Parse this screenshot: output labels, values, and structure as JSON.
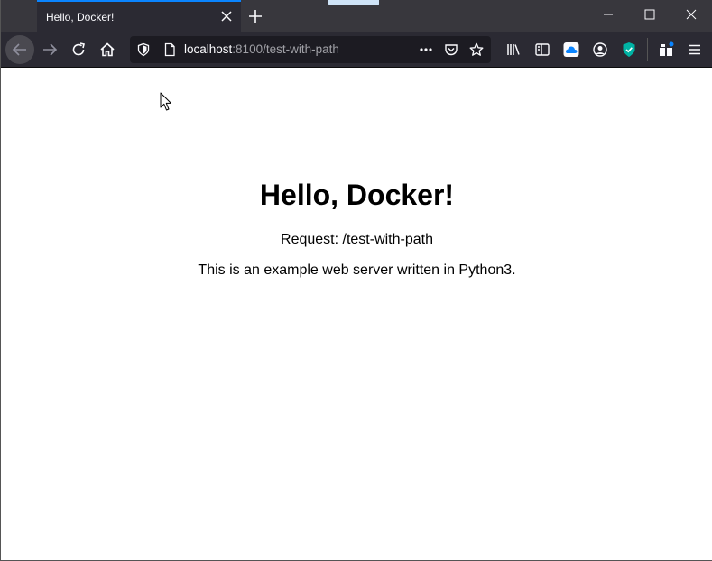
{
  "browser": {
    "tab": {
      "title": "Hello, Docker!"
    },
    "url": {
      "host": "localhost",
      "rest": ":8100/test-with-path"
    }
  },
  "page": {
    "heading": "Hello, Docker!",
    "request_line": "Request: /test-with-path",
    "description": "This is an example web server written in Python3."
  },
  "colors": {
    "tab_accent": "#0a84ff",
    "toolbar_bg": "#2b2a33",
    "tabstrip_bg": "#38373d",
    "vpn_shield": "#00b3a4",
    "cloud_icon": "#0a84ff"
  }
}
